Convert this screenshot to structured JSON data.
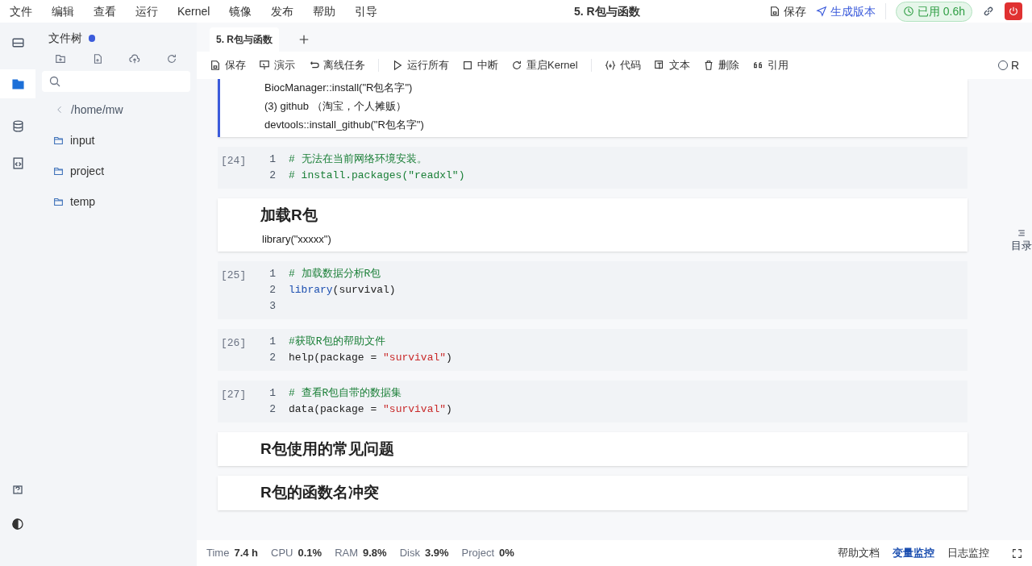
{
  "menu": [
    "文件",
    "编辑",
    "查看",
    "运行",
    "Kernel",
    "镜像",
    "发布",
    "帮助",
    "引导"
  ],
  "title": "5. R包与函数",
  "header_actions": {
    "save": "保存",
    "publish": "生成版本",
    "usage": "已用 0.6h"
  },
  "file_panel": {
    "title": "文件树",
    "path": "/home/mw",
    "items": [
      "input",
      "project",
      "temp"
    ]
  },
  "tabs": [
    {
      "label": "5. R包与函数",
      "selected": true
    }
  ],
  "toolbar": [
    "保存",
    "演示",
    "离线任务",
    "运行所有",
    "中断",
    "重启Kernel",
    "代码",
    "文本",
    "删除",
    "引用"
  ],
  "kernel": "R",
  "cells": [
    {
      "kind": "markdown",
      "selected": true,
      "lines": [
        "BiocManager::install(\"R包名字\")",
        "(3) github （淘宝，个人摊贩）",
        "devtools::install_github(\"R包名字\")"
      ]
    },
    {
      "kind": "code",
      "selected": false,
      "prompt": "[24]",
      "lines": [
        {
          "number": "1",
          "tokens": [
            {
              "text": "# 无法在当前网络环境安装。",
              "kind": "comment"
            }
          ]
        },
        {
          "number": "2",
          "tokens": [
            {
              "text": "# install.packages(\"readxl\")",
              "kind": "comment"
            }
          ]
        }
      ]
    },
    {
      "kind": "markdown",
      "selected": false,
      "heading": "加载R包",
      "lines": [
        "library(\"xxxxx\")"
      ]
    },
    {
      "kind": "code",
      "selected": false,
      "prompt": "[25]",
      "lines": [
        {
          "number": "1",
          "tokens": [
            {
              "text": "# 加载数据分析R包",
              "kind": "comment"
            }
          ]
        },
        {
          "number": "2",
          "tokens": [
            {
              "text": "library",
              "kind": "keyword"
            },
            {
              "text": "(survival)",
              "kind": "plain"
            }
          ]
        },
        {
          "number": "3"
        }
      ]
    },
    {
      "kind": "code",
      "selected": false,
      "prompt": "[26]",
      "lines": [
        {
          "number": "1",
          "tokens": [
            {
              "text": "#获取R包的帮助文件",
              "kind": "comment"
            }
          ]
        },
        {
          "number": "2",
          "tokens": [
            {
              "text": "help(package = ",
              "kind": "plain"
            },
            {
              "text": "\"survival\"",
              "kind": "string"
            },
            {
              "text": ")",
              "kind": "plain"
            }
          ]
        }
      ]
    },
    {
      "kind": "code",
      "selected": false,
      "prompt": "[27]",
      "lines": [
        {
          "number": "1",
          "tokens": [
            {
              "text": "# 查看R包自带的数据集",
              "kind": "comment"
            }
          ]
        },
        {
          "number": "2",
          "tokens": [
            {
              "text": "data(package = ",
              "kind": "plain"
            },
            {
              "text": "\"survival\"",
              "kind": "string"
            },
            {
              "text": ")",
              "kind": "plain"
            }
          ]
        }
      ]
    },
    {
      "kind": "markdown",
      "selected": false,
      "heading": "R包使用的常见问题"
    },
    {
      "kind": "markdown",
      "selected": false,
      "heading": "R包的函数名冲突"
    }
  ],
  "sidebar_tabs": [
    {
      "selected": false
    },
    {
      "selected": true
    },
    {
      "selected": false
    },
    {
      "selected": false
    }
  ],
  "toc": "目录",
  "status": [
    {
      "label": "Time",
      "value": "7.4 h"
    },
    {
      "label": "CPU",
      "value": "0.1%"
    },
    {
      "label": "RAM",
      "value": "9.8%"
    },
    {
      "label": "Disk",
      "value": "3.9%"
    },
    {
      "label": "Project",
      "value": "0%"
    }
  ],
  "status_links": [
    {
      "label": "帮助文档",
      "selected": false
    },
    {
      "label": "变量监控",
      "selected": true
    },
    {
      "label": "日志监控",
      "selected": false
    }
  ]
}
